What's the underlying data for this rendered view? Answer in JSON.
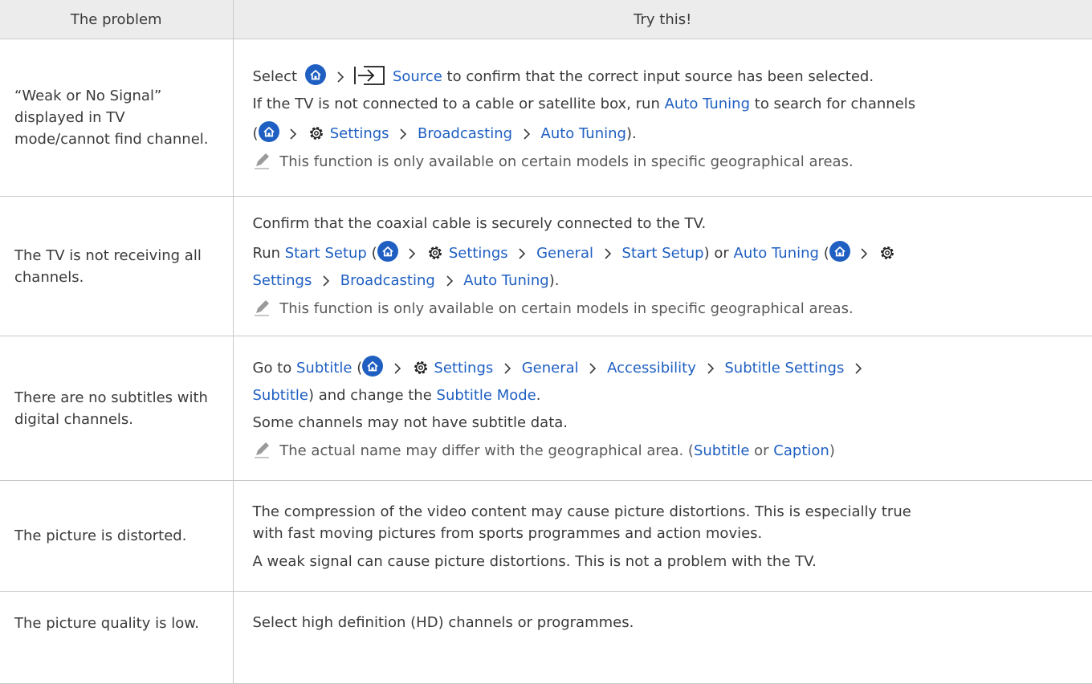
{
  "header": {
    "col1": "The problem",
    "col2": "Try this!"
  },
  "rows": [
    {
      "problem": "“Weak or No Signal” displayed in TV mode/cannot find channel.",
      "select": "Select",
      "source": "Source",
      "source_tail": "to confirm that the correct input source has been selected.",
      "p2_a": "If the TV is not connected to a cable or satellite box, run",
      "auto_tuning": "Auto Tuning",
      "p2_b": "to search for channels",
      "open_paren": "(",
      "settings": "Settings",
      "broadcasting": "Broadcasting",
      "auto_tuning_2": "Auto Tuning",
      "close": ").",
      "note": "This function is only available on certain models in specific geographical areas."
    },
    {
      "problem": "The TV is not receiving all channels.",
      "p1": "Confirm that the coaxial cable is securely connected to the TV.",
      "run": "Run",
      "start_setup": "Start Setup",
      "open_paren": "(",
      "settings": "Settings",
      "general": "General",
      "start_setup_2": "Start Setup",
      "or": ") or",
      "auto_tuning": "Auto Tuning",
      "open_paren_2": "(",
      "settings_2": "Settings",
      "broadcasting": "Broadcasting",
      "auto_tuning_2": "Auto Tuning",
      "close": ").",
      "note": "This function is only available on certain models in specific geographical areas."
    },
    {
      "problem": "There are no subtitles with digital channels.",
      "go_to": "Go to",
      "subtitle": "Subtitle",
      "open_paren": "(",
      "settings": "Settings",
      "general": "General",
      "accessibility": "Accessibility",
      "subtitle_settings": "Subtitle Settings",
      "subtitle_2": "Subtitle",
      "and_change": ") and change the",
      "subtitle_mode": "Subtitle Mode",
      "period": ".",
      "p2": "Some channels may not have subtitle data.",
      "note_a": "The actual name may differ with the geographical area. (",
      "note_subtitle": "Subtitle",
      "note_or": "or",
      "note_caption": "Caption",
      "note_close": ")"
    },
    {
      "problem": "The picture is distorted.",
      "p1a": "The compression of the video content may cause picture distortions. This is especially true",
      "p1b": "with fast moving pictures from sports programmes and action movies.",
      "p2": "A weak signal can cause picture distortions. This is not a problem with the TV."
    },
    {
      "problem": "The picture quality is low.",
      "p1": "Select high definition (HD) channels or programmes."
    }
  ],
  "icons": {
    "home": "home-icon",
    "source": "source-input-icon",
    "settings": "gear-icon",
    "arrow": "chevron-right-icon",
    "note": "pencil-note-icon"
  },
  "colors": {
    "link": "#1f5fc2",
    "header_bg": "#ececec",
    "rule": "#c8c8c8",
    "text": "#3a3a3a"
  }
}
